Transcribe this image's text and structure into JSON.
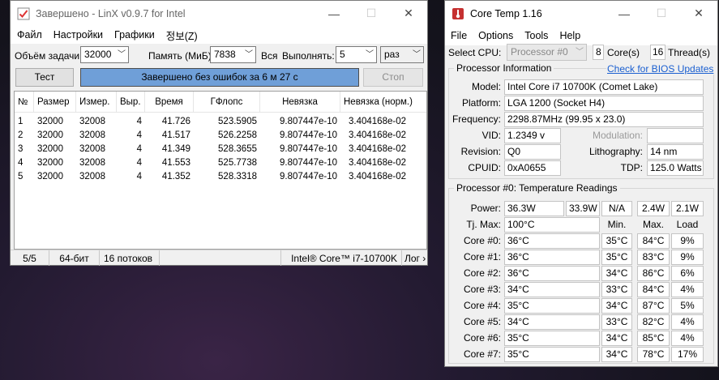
{
  "linx": {
    "title": "Завершено - LinX v0.9.7 for Intel",
    "menu": [
      "Файл",
      "Настройки",
      "Графики",
      "정보(Z)"
    ],
    "task_size_label": "Объём задачи:",
    "task_size_value": "32000",
    "memory_label": "Память (МиБ):",
    "memory_value": "7838",
    "all_label": "Вся",
    "runs_label": "Выполнять:",
    "runs_value": "5",
    "runs_unit": "раз",
    "test_button": "Тест",
    "progress_text": "Завершено без ошибок за 6 м 27 с",
    "progress_fraction": 1.0,
    "stop_button": "Стоп",
    "columns": [
      "№",
      "Размер",
      "Измер.",
      "Выр.",
      "Время",
      "ГФлопс",
      "Невязка",
      "Невязка (норм.)"
    ],
    "rows": [
      [
        "1",
        "32000",
        "32008",
        "4",
        "41.726",
        "523.5905",
        "9.807447e-10",
        "3.404168e-02"
      ],
      [
        "2",
        "32000",
        "32008",
        "4",
        "41.517",
        "526.2258",
        "9.807447e-10",
        "3.404168e-02"
      ],
      [
        "3",
        "32000",
        "32008",
        "4",
        "41.349",
        "528.3655",
        "9.807447e-10",
        "3.404168e-02"
      ],
      [
        "4",
        "32000",
        "32008",
        "4",
        "41.553",
        "525.7738",
        "9.807447e-10",
        "3.404168e-02"
      ],
      [
        "5",
        "32000",
        "32008",
        "4",
        "41.352",
        "528.3318",
        "9.807447e-10",
        "3.404168e-02"
      ]
    ],
    "status": {
      "count": "5/5",
      "bits": "64-бит",
      "threads": "16 потоков",
      "cpu": "Intel® Core™ i7-10700K",
      "log": "Лог ›"
    },
    "colors": {
      "progress_fill": "#6f9fd8"
    }
  },
  "coretemp": {
    "title": "Core Temp 1.16",
    "menu": [
      "File",
      "Options",
      "Tools",
      "Help"
    ],
    "select_cpu_label": "Select CPU:",
    "select_cpu_value": "Processor #0",
    "cores_value": "8",
    "cores_label": "Core(s)",
    "threads_value": "16",
    "threads_label": "Thread(s)",
    "proc_info_title": "Processor Information",
    "bios_link": "Check for BIOS Updates",
    "model_label": "Model:",
    "model_value": "Intel Core i7 10700K (Comet Lake)",
    "platform_label": "Platform:",
    "platform_value": "LGA 1200 (Socket H4)",
    "frequency_label": "Frequency:",
    "frequency_value": "2298.87MHz (99.95 x 23.0)",
    "vid_label": "VID:",
    "vid_value": "1.2349 v",
    "modulation_label": "Modulation:",
    "modulation_value": "",
    "revision_label": "Revision:",
    "revision_value": "Q0",
    "lithography_label": "Lithography:",
    "lithography_value": "14 nm",
    "cpuid_label": "CPUID:",
    "cpuid_value": "0xA0655",
    "tdp_label": "TDP:",
    "tdp_value": "125.0 Watts",
    "temp_title": "Processor #0: Temperature Readings",
    "power_label": "Power:",
    "power_values": [
      "36.3W",
      "33.9W",
      "N/A",
      "2.4W",
      "2.1W"
    ],
    "tjmax_label": "Tj. Max:",
    "tjmax_value": "100°C",
    "col_min": "Min.",
    "col_max": "Max.",
    "col_load": "Load",
    "cores": [
      {
        "label": "Core #0:",
        "temp": "36°C",
        "min": "35°C",
        "max": "84°C",
        "load": "9%"
      },
      {
        "label": "Core #1:",
        "temp": "36°C",
        "min": "35°C",
        "max": "83°C",
        "load": "9%"
      },
      {
        "label": "Core #2:",
        "temp": "36°C",
        "min": "34°C",
        "max": "86°C",
        "load": "6%"
      },
      {
        "label": "Core #3:",
        "temp": "34°C",
        "min": "33°C",
        "max": "84°C",
        "load": "4%"
      },
      {
        "label": "Core #4:",
        "temp": "35°C",
        "min": "34°C",
        "max": "87°C",
        "load": "5%"
      },
      {
        "label": "Core #5:",
        "temp": "34°C",
        "min": "33°C",
        "max": "82°C",
        "load": "4%"
      },
      {
        "label": "Core #6:",
        "temp": "35°C",
        "min": "34°C",
        "max": "85°C",
        "load": "4%"
      },
      {
        "label": "Core #7:",
        "temp": "35°C",
        "min": "34°C",
        "max": "78°C",
        "load": "17%"
      }
    ]
  }
}
